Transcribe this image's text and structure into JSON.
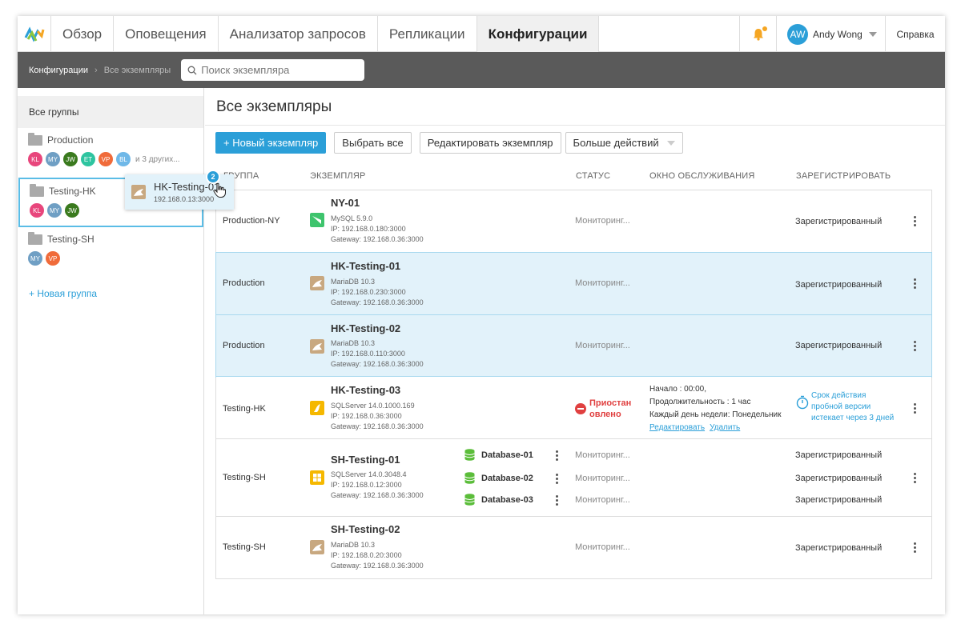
{
  "nav": {
    "tabs": [
      {
        "label": "Обзор"
      },
      {
        "label": "Оповещения"
      },
      {
        "label": "Анализатор запросов"
      },
      {
        "label": "Репликации"
      },
      {
        "label": "Конфигурации"
      }
    ],
    "user": {
      "initials": "AW",
      "name": "Andy Wong"
    },
    "help": "Справка"
  },
  "subbar": {
    "crumb_root": "Конфигурации",
    "crumb_current": "Все экземпляры",
    "search_placeholder": "Поиск экземпляра"
  },
  "sidebar": {
    "all_groups": "Все группы",
    "groups": [
      {
        "name": "Production",
        "members": [
          {
            "initials": "KL",
            "color": "#e8467c"
          },
          {
            "initials": "MY",
            "color": "#6f9fc4"
          },
          {
            "initials": "JW",
            "color": "#3a7a1e"
          },
          {
            "initials": "ET",
            "color": "#2ec4a0"
          },
          {
            "initials": "VP",
            "color": "#f06b3a"
          },
          {
            "initials": "BL",
            "color": "#6fb8e8"
          }
        ],
        "more": "и 3 других..."
      },
      {
        "name": "Testing-HK",
        "members": [
          {
            "initials": "KL",
            "color": "#e8467c"
          },
          {
            "initials": "MY",
            "color": "#6f9fc4"
          },
          {
            "initials": "JW",
            "color": "#3a7a1e"
          }
        ]
      },
      {
        "name": "Testing-SH",
        "members": [
          {
            "initials": "MY",
            "color": "#6f9fc4"
          },
          {
            "initials": "VP",
            "color": "#f06b3a"
          }
        ]
      }
    ],
    "new_group": "+ Новая группа"
  },
  "drag": {
    "name": "HK-Testing-01",
    "ip": "192.168.0.13:3000",
    "count": "2"
  },
  "main": {
    "title": "Все экземпляры",
    "toolbar": {
      "new_instance": "+ Новый экземпляр",
      "select_all": "Выбрать все",
      "edit_instance": "Редактировать экземпляр",
      "more_actions": "Больше действий"
    },
    "columns": {
      "group": "ГРУППА",
      "instance": "ЭКЗЕМПЛЯР",
      "status": "СТАТУС",
      "maintenance": "ОКНО ОБСЛУЖИВАНИЯ",
      "register": "ЗАРЕГИСТРИРОВАТЬ"
    },
    "rows": [
      {
        "group": "Production-NY",
        "name": "NY-01",
        "engine": "MySQL 5.9.0",
        "ip": "IP: 192.168.0.180:3000",
        "gateway": "Gateway: 192.168.0.36:3000",
        "status": "Мониторинг...",
        "register": "Зарегистрированный"
      },
      {
        "group": "Production",
        "name": "HK-Testing-01",
        "engine": "MariaDB 10.3",
        "ip": "IP: 192.168.0.230:3000",
        "gateway": "Gateway: 192.168.0.36:3000",
        "status": "Мониторинг...",
        "register": "Зарегистрированный"
      },
      {
        "group": "Production",
        "name": "HK-Testing-02",
        "engine": "MariaDB 10.3",
        "ip": "IP: 192.168.0.110:3000",
        "gateway": "Gateway: 192.168.0.36:3000",
        "status": "Мониторинг...",
        "register": "Зарегистрированный"
      },
      {
        "group": "Testing-HK",
        "name": "HK-Testing-03",
        "engine": "SQLServer 14.0.1000.169",
        "ip": "IP: 192.168.0.36:3000",
        "gateway": "Gateway: 192.168.0.36:3000",
        "status_line1": "Приостан",
        "status_line2": "овлено",
        "maint_start": "Начало : 00:00,",
        "maint_duration": "Продолжительность : 1  час",
        "maint_repeat": "Каждый день недели: Понедельник",
        "maint_edit": "Редактировать",
        "maint_delete": "Удалить",
        "trial1": "Срок действия",
        "trial2": "пробной версии",
        "trial3": "истекает через 3 дней"
      },
      {
        "group": "Testing-SH",
        "name": "SH-Testing-01",
        "engine": "SQLServer 14.0.3048.4",
        "ip": "IP: 192.168.0.12:3000",
        "gateway": "Gateway: 192.168.0.36:3000",
        "databases": [
          {
            "name": "Database-01",
            "status": "Мониторинг...",
            "register": "Зарегистрированный"
          },
          {
            "name": "Database-02",
            "status": "Мониторинг...",
            "register": "Зарегистрированный"
          },
          {
            "name": "Database-03",
            "status": "Мониторинг...",
            "register": "Зарегистрированный"
          }
        ]
      },
      {
        "group": "Testing-SH",
        "name": "SH-Testing-02",
        "engine": "MariaDB 10.3",
        "ip": "IP: 192.168.0.20:3000",
        "gateway": "Gateway: 192.168.0.36:3000",
        "status": "Мониторинг...",
        "register": "Зарегистрированный"
      }
    ]
  }
}
